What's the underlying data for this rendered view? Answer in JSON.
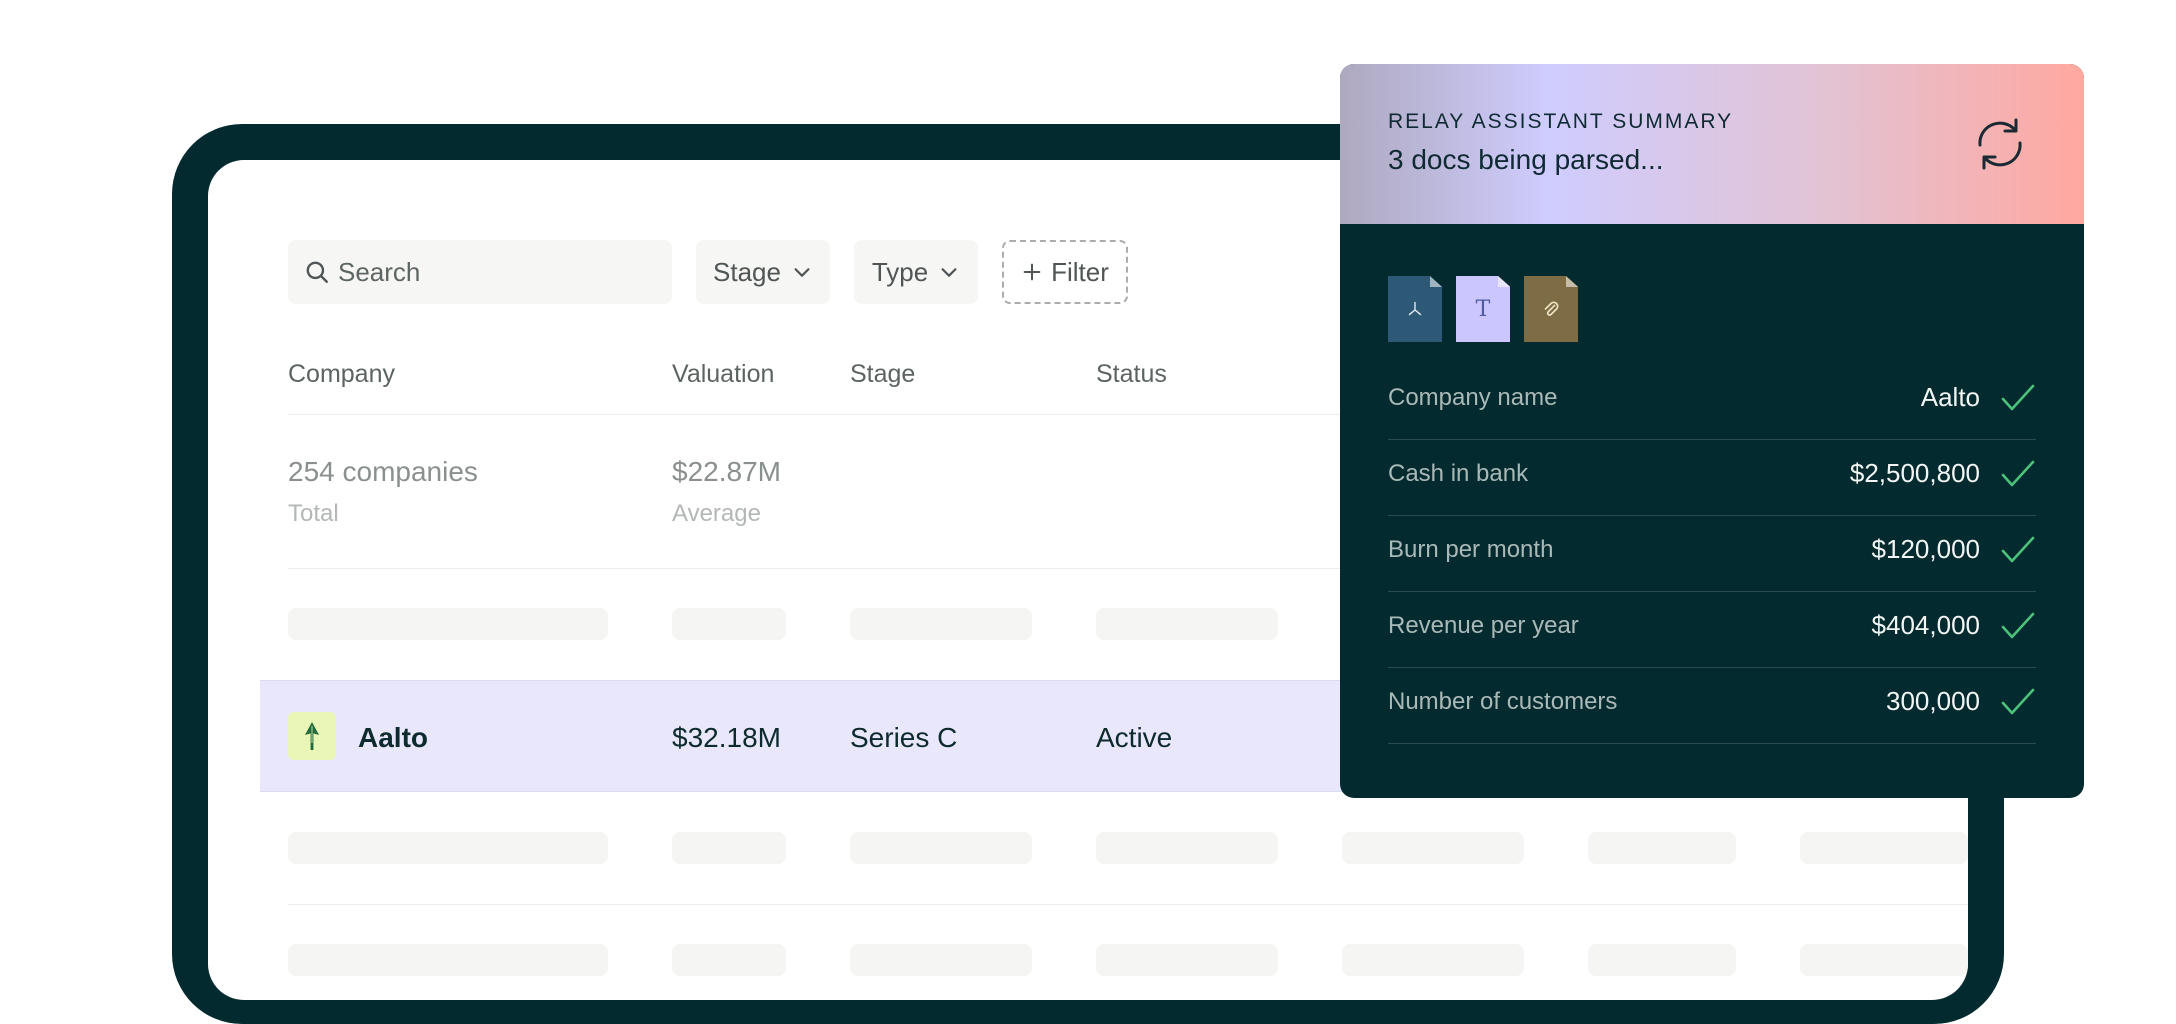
{
  "toolbar": {
    "search_placeholder": "Search",
    "stage_label": "Stage",
    "type_label": "Type",
    "filter_label": "Filter"
  },
  "table": {
    "headers": [
      "Company",
      "Valuation",
      "Stage",
      "Status"
    ],
    "summary": {
      "count": "254 companies",
      "count_label": "Total",
      "valuation": "$22.87M",
      "valuation_label": "Average"
    },
    "highlighted_row": {
      "company": "Aalto",
      "valuation": "$32.18M",
      "stage": "Series C",
      "status": "Active"
    }
  },
  "assistant": {
    "kicker": "RELAY ASSISTANT SUMMARY",
    "title": "3 docs being parsed...",
    "docs": [
      "pdf-icon",
      "text-icon",
      "attachment-icon"
    ],
    "fields": [
      {
        "label": "Company name",
        "value": "Aalto"
      },
      {
        "label": "Cash in bank",
        "value": "$2,500,800"
      },
      {
        "label": "Burn per month",
        "value": "$120,000"
      },
      {
        "label": "Revenue per year",
        "value": "$404,000"
      },
      {
        "label": "Number of customers",
        "value": "300,000"
      }
    ]
  },
  "colors": {
    "frame": "#032a2e",
    "highlight_row": "#e9e7fb",
    "check": "#4cc27a",
    "logo_bg": "#eaf6b8"
  }
}
